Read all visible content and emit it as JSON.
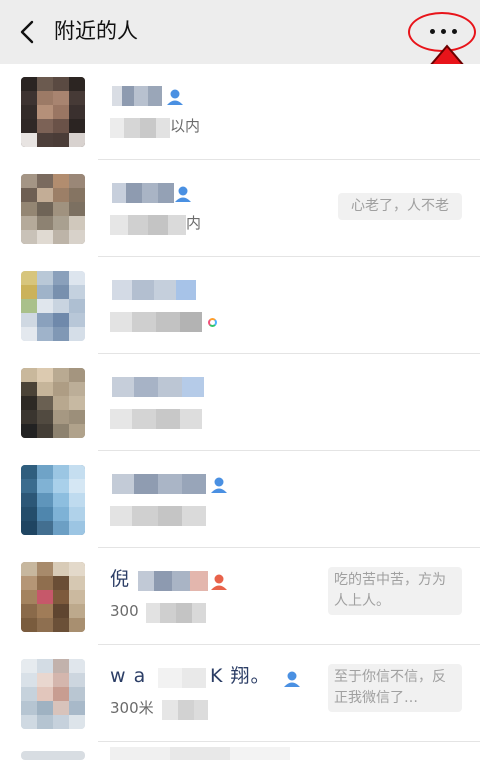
{
  "header": {
    "title": "附近的人",
    "back_icon": "chevron-left-icon",
    "more_icon": "more-icon",
    "highlight_color": "#e8141a"
  },
  "rows": [
    {
      "name": "",
      "distance": "以内",
      "signature": "",
      "gender_color": "#4a90e2"
    },
    {
      "name": "",
      "distance": "内",
      "signature": "心老了，人不老",
      "gender_color": "#4a90e2"
    },
    {
      "name": "",
      "distance": "",
      "signature": "",
      "gender_color": "#4a90e2"
    },
    {
      "name": "",
      "distance": "",
      "signature": "",
      "gender_color": "#4a90e2"
    },
    {
      "name": "",
      "distance": "",
      "signature": "",
      "gender_color": "#4a90e2"
    },
    {
      "name": "倪",
      "distance": "300",
      "signature": "吃的苦中苦，方为人上人。",
      "gender_color": "#e8624a"
    },
    {
      "name": "w a",
      "name_tail": "K 翔。",
      "distance": "300米",
      "signature": "至于你信不信，反正我微信了…",
      "gender_color": "#4a90e2"
    }
  ]
}
